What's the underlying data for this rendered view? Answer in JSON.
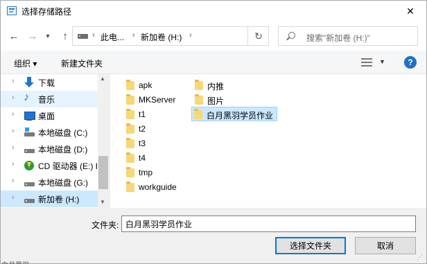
{
  "window": {
    "title": "选择存储路径",
    "close_glyph": "✕"
  },
  "address": {
    "segments": [
      "此电...",
      "新加卷 (H:)"
    ],
    "search_placeholder": "搜索\"新加卷 (H:)\""
  },
  "toolbar": {
    "organize": "组织 ▾",
    "new_folder": "新建文件夹",
    "help": "?"
  },
  "navpane": {
    "items": [
      {
        "label": "下载",
        "icon": "download-icon"
      },
      {
        "label": "音乐",
        "icon": "music-icon"
      },
      {
        "label": "桌面",
        "icon": "desktop-icon"
      },
      {
        "label": "本地磁盘 (C:)",
        "icon": "windows-drive-icon"
      },
      {
        "label": "本地磁盘 (D:)",
        "icon": "drive-icon"
      },
      {
        "label": "CD 驱动器 (E:) I",
        "icon": "cd-drive-icon"
      },
      {
        "label": "本地磁盘 (G:)",
        "icon": "drive-icon"
      },
      {
        "label": "新加卷 (H:)",
        "icon": "drive-icon"
      }
    ]
  },
  "files": {
    "column1": [
      "apk",
      "MKServer",
      "t1",
      "t2",
      "t3",
      "t4",
      "tmp",
      "workguide"
    ],
    "column2": [
      "内推",
      "图片",
      "白月黑羽学员作业"
    ]
  },
  "footer": {
    "filename_label": "文件夹:",
    "filename_value": "白月黑羽学员作业",
    "select_button": "选择文件夹",
    "cancel_button": "取消",
    "clipped_text": "白月黑羽"
  }
}
